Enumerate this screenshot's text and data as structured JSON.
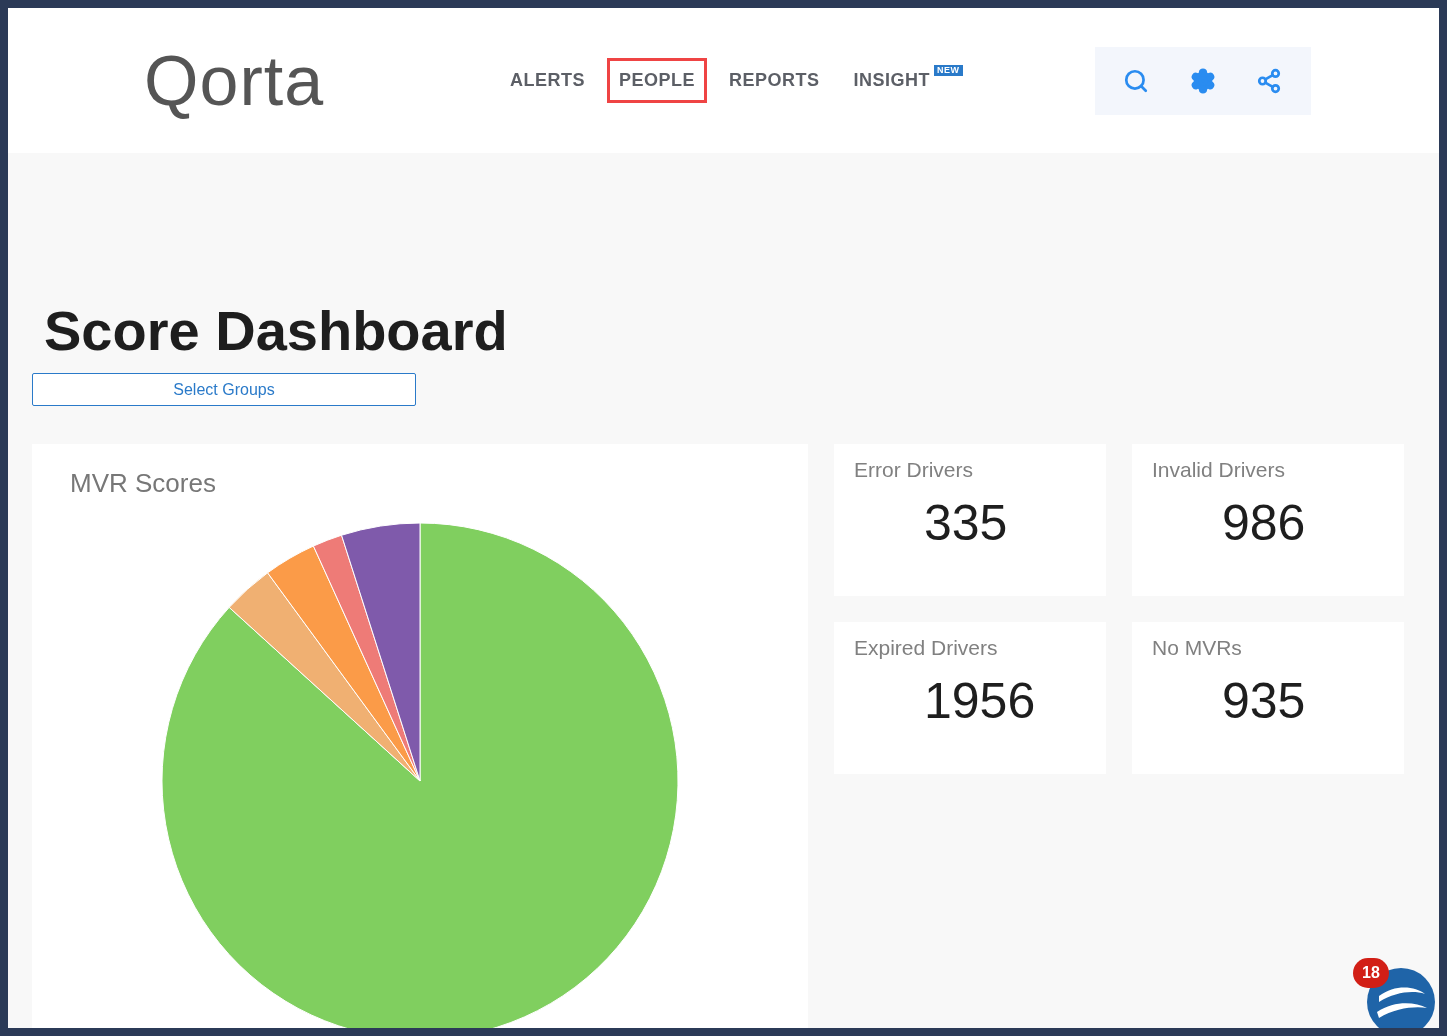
{
  "logo": {
    "text": "Qorta"
  },
  "nav": [
    {
      "label": "ALERTS",
      "selected": false
    },
    {
      "label": "PEOPLE",
      "selected": true
    },
    {
      "label": "REPORTS",
      "selected": false
    },
    {
      "label": "INSIGHT",
      "selected": false,
      "badge": "NEW"
    }
  ],
  "title": "Score Dashboard",
  "select_groups": {
    "label": "Select Groups"
  },
  "mvr_card": {
    "title": "MVR Scores"
  },
  "stats": [
    {
      "label": "Error Drivers",
      "value": "335"
    },
    {
      "label": "Invalid Drivers",
      "value": "986"
    },
    {
      "label": "Expired Drivers",
      "value": "1956"
    },
    {
      "label": "No MVRs",
      "value": "935"
    }
  ],
  "chat": {
    "badge": "18"
  }
}
